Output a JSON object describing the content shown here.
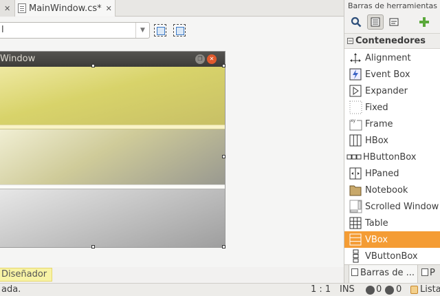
{
  "editor": {
    "tabs": [
      {
        "label": "",
        "close": "✕"
      },
      {
        "label": "MainWindow.cs*",
        "close": "✕"
      }
    ],
    "combo": {
      "value": "l"
    },
    "preview": {
      "title": "Window"
    },
    "designer_tab": "Diseñador"
  },
  "toolbox": {
    "title": "Barras de herramientas",
    "category": "Contenedores",
    "items": [
      {
        "label": "Alignment",
        "icon": "alignment-icon"
      },
      {
        "label": "Event Box",
        "icon": "event-box-icon"
      },
      {
        "label": "Expander",
        "icon": "expander-icon"
      },
      {
        "label": "Fixed",
        "icon": "fixed-icon"
      },
      {
        "label": "Frame",
        "icon": "frame-icon"
      },
      {
        "label": "HBox",
        "icon": "hbox-icon"
      },
      {
        "label": "HButtonBox",
        "icon": "hbuttonbox-icon"
      },
      {
        "label": "HPaned",
        "icon": "hpaned-icon"
      },
      {
        "label": "Notebook",
        "icon": "notebook-icon"
      },
      {
        "label": "Scrolled Window",
        "icon": "scrolled-window-icon"
      },
      {
        "label": "Table",
        "icon": "table-icon"
      },
      {
        "label": "VBox",
        "icon": "vbox-icon",
        "selected": true
      },
      {
        "label": "VButtonBox",
        "icon": "vbuttonbox-icon"
      }
    ],
    "panel_tabs": [
      "Barras de ...",
      "P"
    ]
  },
  "status": {
    "message": "ada.",
    "position": "1 : 1",
    "mode": "INS",
    "errors": "0",
    "warnings": "0",
    "tasks": "Lista"
  },
  "colors": {
    "selection": "#f49c34",
    "titlebar": "#3d3c39",
    "designer_tab": "#f8f3a5"
  }
}
